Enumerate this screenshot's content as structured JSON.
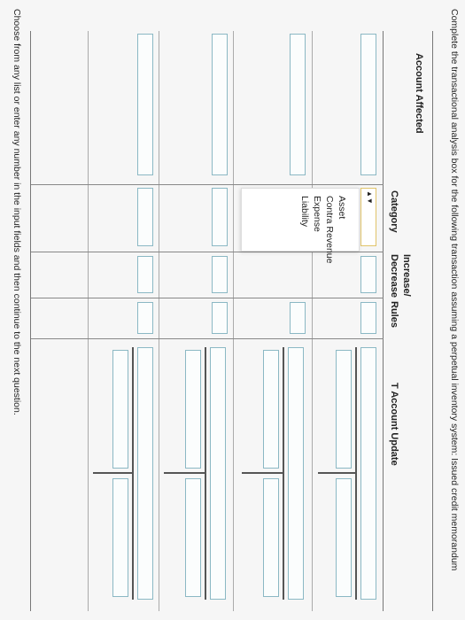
{
  "instructions": "Complete the transactional analysis box for the following transaction assuming a perpetual inventory system: Issued credit memorandum",
  "headers": {
    "account_affected": "Account Affected",
    "category": "Category",
    "increase_decrease_line1": "Increase/",
    "increase_decrease_line2": "Decrease",
    "rules": "Rules",
    "t_account_update": "T Account Update"
  },
  "category_dropdown": {
    "arrows": "▲▼",
    "options": [
      "Asset",
      "Contra Revenue",
      "Expense",
      "Liability"
    ]
  },
  "footer": "Choose from any list or enter any number in the input fields and then continue to the next question."
}
